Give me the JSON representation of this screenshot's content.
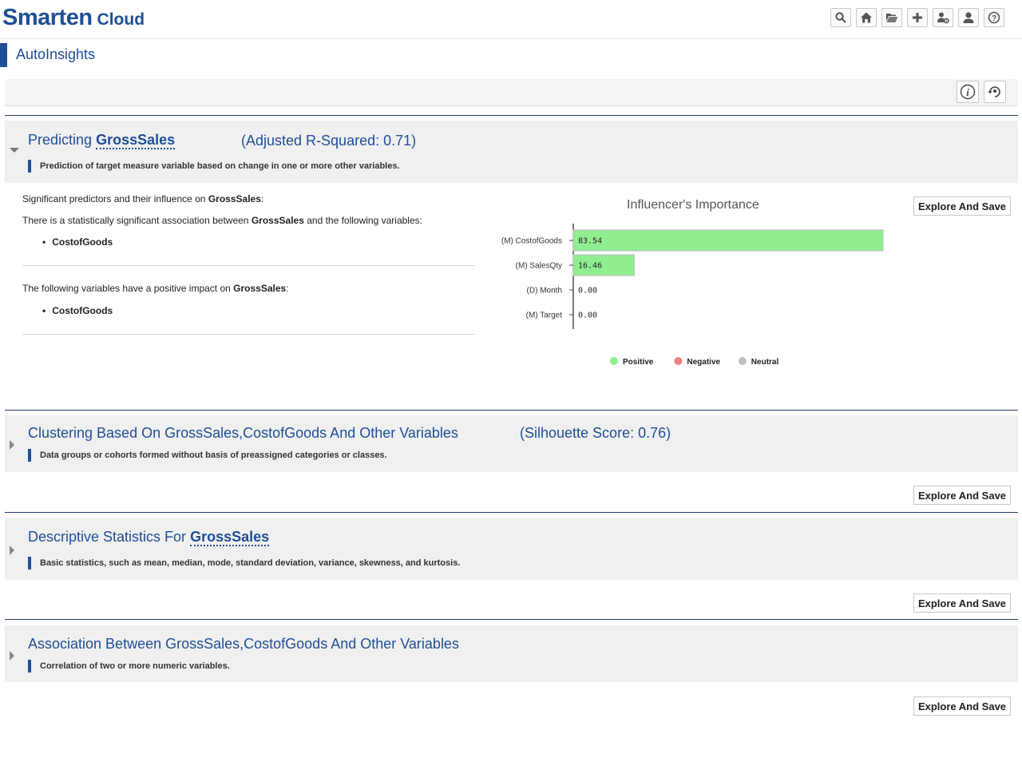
{
  "app": {
    "logo_main": "Smarten",
    "logo_sub": "Cloud",
    "page_title": "AutoInsights"
  },
  "toolbar": [
    {
      "icon": "search-icon"
    },
    {
      "icon": "home-icon"
    },
    {
      "icon": "folder-open-icon"
    },
    {
      "icon": "plus-icon"
    },
    {
      "icon": "user-settings-icon"
    },
    {
      "icon": "user-icon"
    },
    {
      "icon": "help-icon"
    }
  ],
  "sections": {
    "prediction": {
      "title_prefix": "Predicting",
      "target": "GrossSales",
      "score": "(Adjusted R-Squared: 0.71)",
      "description": "Prediction of target measure variable based on change in one or more other variables.",
      "sig_line_pre": "Significant predictors and their influence on",
      "sig_line_post": ":",
      "assoc_line_pre": "There is a statistically significant association between",
      "assoc_line_post": "and the following variables:",
      "assoc_vars": [
        "CostofGoods"
      ],
      "positive_line_pre": "The following variables have a positive impact on",
      "positive_line_post": ":",
      "positive_vars": [
        "CostofGoods"
      ],
      "explore_label": "Explore And Save"
    },
    "clustering": {
      "title": "Clustering Based On GrossSales,CostofGoods And Other Variables",
      "score": "(Silhouette Score: 0.76)",
      "description": "Data groups or cohorts formed without basis of preassigned categories or classes.",
      "explore_label": "Explore And Save"
    },
    "descriptive": {
      "title_prefix": "Descriptive Statistics For",
      "target": "GrossSales",
      "description": "Basic statistics, such as mean, median, mode, standard deviation, variance, skewness, and kurtosis.",
      "explore_label": "Explore And Save"
    },
    "association": {
      "title": "Association Between GrossSales,CostofGoods And Other Variables",
      "description": "Correlation of two or more numeric variables.",
      "explore_label": "Explore And Save"
    }
  },
  "chart_data": {
    "type": "bar",
    "orientation": "horizontal",
    "title": "Influencer's Importance",
    "categories": [
      "(M) CostofGoods",
      "(M) SalesQty",
      "(D) Month",
      "(M) Target"
    ],
    "values": [
      83.54,
      16.46,
      0.0,
      0.0
    ],
    "value_labels": [
      "83.54",
      "16.46",
      "0.00",
      "0.00"
    ],
    "xlim": [
      0,
      83.54
    ],
    "legend_position": "bottom",
    "legend": [
      {
        "name": "Positive",
        "color": "#90ee90"
      },
      {
        "name": "Negative",
        "color": "#f08080"
      },
      {
        "name": "Neutral",
        "color": "#c0c0c0"
      }
    ],
    "bar_color": "#90ee90"
  }
}
